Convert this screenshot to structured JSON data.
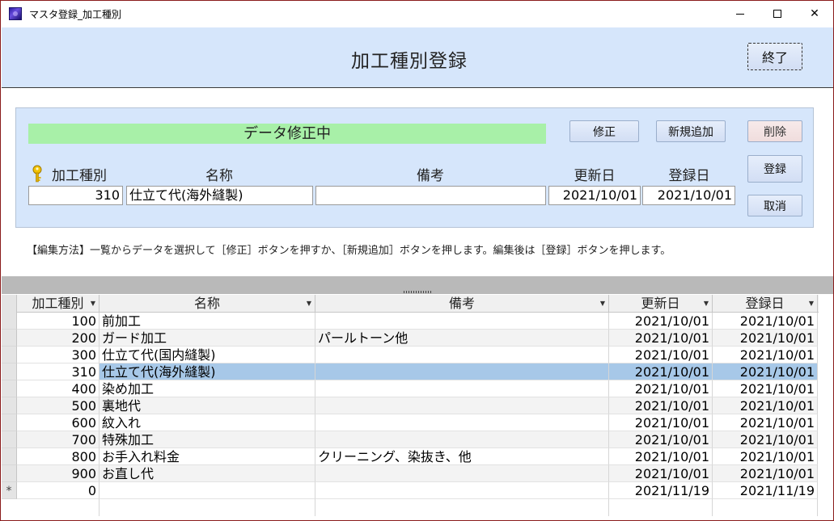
{
  "window": {
    "title": "マスタ登録_加工種別",
    "min": "minimize",
    "max": "maximize",
    "close": "✕"
  },
  "header": {
    "title": "加工種別登録",
    "exit_label": "終了"
  },
  "panel": {
    "status": "データ修正中",
    "buttons": {
      "edit": "修正",
      "new": "新規追加",
      "delete": "削除",
      "register": "登録",
      "cancel": "取消"
    },
    "labels": {
      "code": "加工種別",
      "name": "名称",
      "remarks": "備考",
      "updated": "更新日",
      "registered": "登録日"
    },
    "values": {
      "code": "310",
      "name": "仕立て代(海外縫製)",
      "remarks": "",
      "updated": "2021/10/01",
      "registered": "2021/10/01"
    }
  },
  "note": "【編集方法】一覧からデータを選択して［修正］ボタンを押すか、［新規追加］ボタンを押します。編集後は［登録］ボタンを押します。",
  "grid": {
    "headers": [
      "加工種別",
      "名称",
      "備考",
      "更新日",
      "登録日"
    ],
    "rows": [
      [
        "100",
        "前加工",
        "",
        "2021/10/01",
        "2021/10/01"
      ],
      [
        "200",
        "ガード加工",
        "パールトーン他",
        "2021/10/01",
        "2021/10/01"
      ],
      [
        "300",
        "仕立て代(国内縫製)",
        "",
        "2021/10/01",
        "2021/10/01"
      ],
      [
        "310",
        "仕立て代(海外縫製)",
        "",
        "2021/10/01",
        "2021/10/01"
      ],
      [
        "400",
        "染め加工",
        "",
        "2021/10/01",
        "2021/10/01"
      ],
      [
        "500",
        "裏地代",
        "",
        "2021/10/01",
        "2021/10/01"
      ],
      [
        "600",
        "紋入れ",
        "",
        "2021/10/01",
        "2021/10/01"
      ],
      [
        "700",
        "特殊加工",
        "",
        "2021/10/01",
        "2021/10/01"
      ],
      [
        "800",
        "お手入れ料金",
        "クリーニング、染抜き、他",
        "2021/10/01",
        "2021/10/01"
      ],
      [
        "900",
        "お直し代",
        "",
        "2021/10/01",
        "2021/10/01"
      ]
    ],
    "new_row": {
      "marker": "*",
      "values": [
        "0",
        "",
        "",
        "2021/11/19",
        "2021/11/19"
      ]
    },
    "selected_index": 3
  },
  "colors": {
    "header_bg": "#d6e6fb",
    "status_bg": "#a8f0a8",
    "selected_row": "#a7c8e8"
  }
}
